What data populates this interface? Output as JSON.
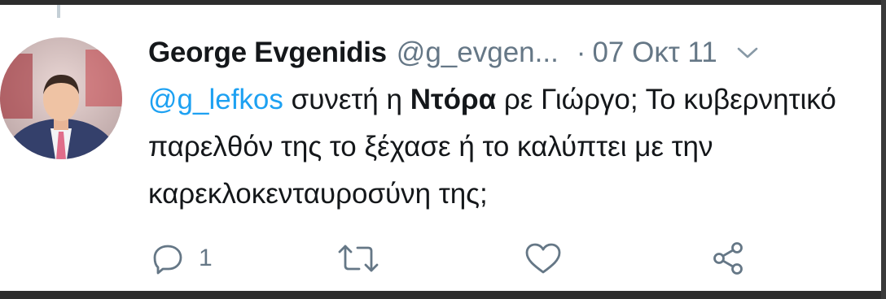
{
  "tweet": {
    "author_name": "George Evgenidis",
    "author_handle": "@g_evgen...",
    "separator": "·",
    "date": "07 Οκτ 11",
    "text": {
      "mention": "@g_lefkos",
      "part1": " συνετή η ",
      "bold": "Ντόρα",
      "part2": " ρε Γιώργο; Το κυβερνητικό παρελθόν της το ξέχασε ή το καλύπτει με την καρεκλοκενταυροσύνη της;"
    },
    "actions": {
      "reply_count": "1"
    }
  },
  "icons": {
    "menu": "chevron-down-icon",
    "reply": "reply-icon",
    "retweet": "retweet-icon",
    "like": "heart-icon",
    "share": "share-icon"
  },
  "colors": {
    "mention": "#1da1f2",
    "secondary_text": "#657786",
    "primary_text": "#14171a",
    "background": "#ffffff"
  }
}
